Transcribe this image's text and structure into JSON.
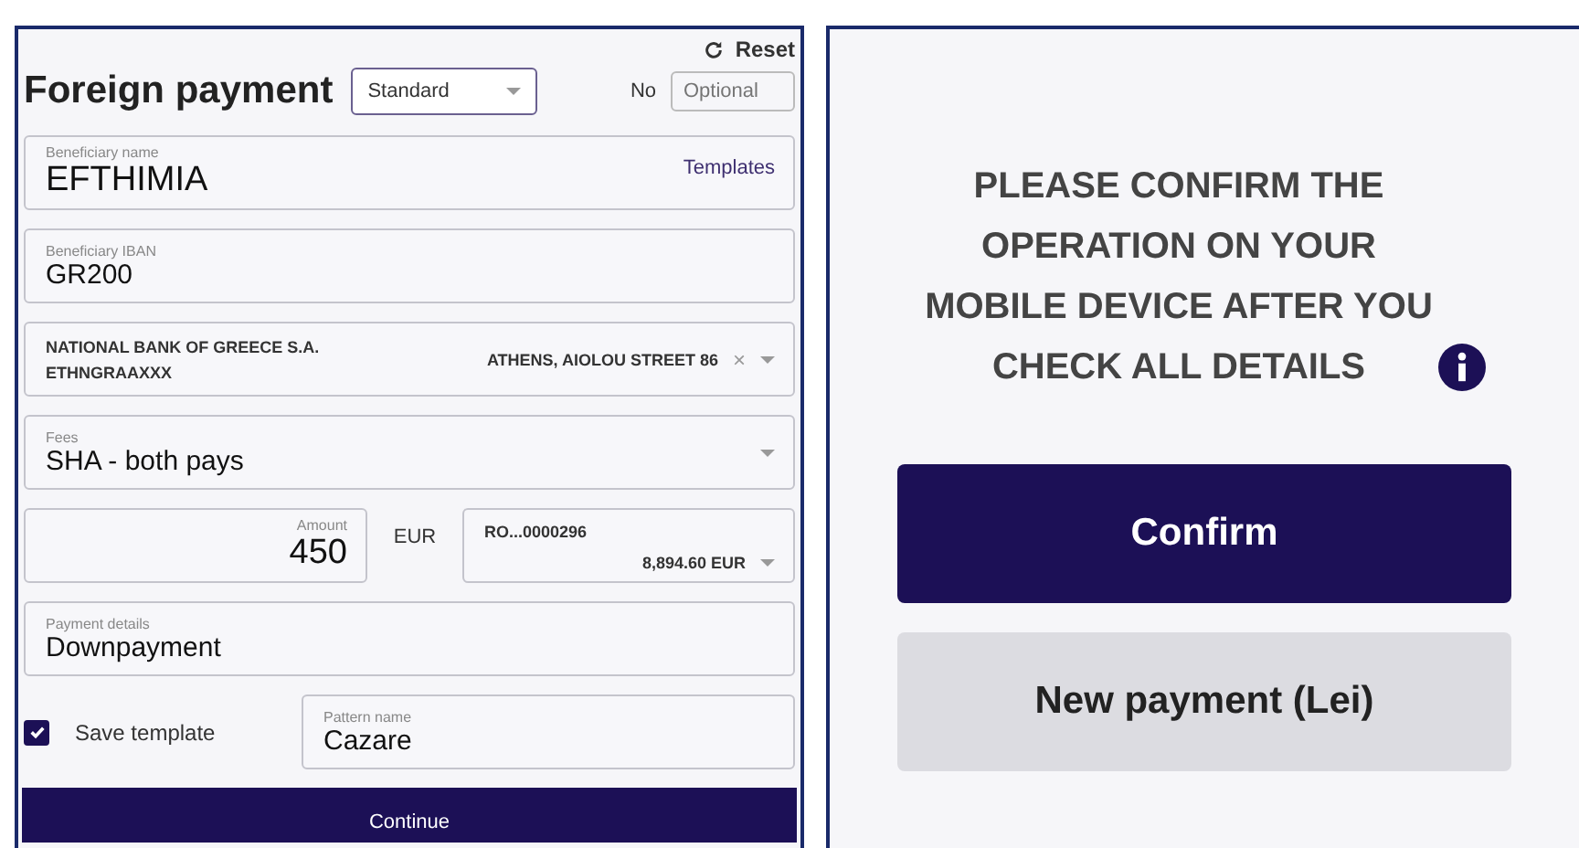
{
  "header": {
    "reset": "Reset",
    "title": "Foreign payment",
    "type_select": {
      "value": "Standard"
    },
    "number": {
      "label": "No",
      "placeholder": "Optional"
    }
  },
  "beneficiary_name": {
    "label": "Beneficiary name",
    "value": "EFTHIMIA",
    "link": "Templates"
  },
  "beneficiary_iban": {
    "label": "Beneficiary IBAN",
    "value": "GR200"
  },
  "bank": {
    "name": "NATIONAL BANK OF GREECE S.A.",
    "bic": "ETHNGRAAXXX",
    "address": "ATHENS, AIOLOU STREET 86",
    "clear": "×"
  },
  "fees": {
    "label": "Fees",
    "value": "SHA - both pays"
  },
  "amount": {
    "label": "Amount",
    "value": "450",
    "currency": "EUR"
  },
  "account": {
    "number": "RO...0000296",
    "balance": "8,894.60 EUR"
  },
  "payment_details": {
    "label": "Payment details",
    "value": "Downpayment"
  },
  "save_template": {
    "label": "Save template",
    "checked": true
  },
  "pattern_name": {
    "label": "Pattern name",
    "value": "Cazare"
  },
  "continue": "Continue",
  "confirmation": {
    "message": "PLEASE CONFIRM THE OPERATION ON YOUR MOBILE DEVICE AFTER YOU CHECK ALL DETAILS",
    "confirm": "Confirm",
    "new_payment": "New payment (Lei)"
  }
}
